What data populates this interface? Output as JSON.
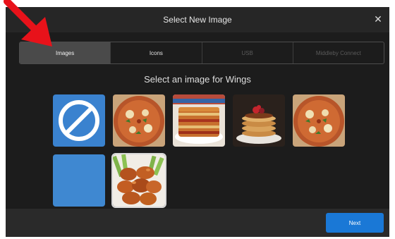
{
  "dialog": {
    "title": "Select New Image",
    "close_glyph": "✕",
    "prompt": "Select an image for Wings"
  },
  "tabs": [
    {
      "label": "Images",
      "state": "active"
    },
    {
      "label": "Icons",
      "state": "enabled"
    },
    {
      "label": "USB",
      "state": "disabled"
    },
    {
      "label": "Middleby Connect",
      "state": "disabled"
    }
  ],
  "images": [
    {
      "name": "no-image-icon",
      "kind": "blocked",
      "color": "#3a82cf"
    },
    {
      "name": "pizza",
      "kind": "photo"
    },
    {
      "name": "lasagna",
      "kind": "photo"
    },
    {
      "name": "pancakes",
      "kind": "photo"
    },
    {
      "name": "pizza",
      "kind": "photo"
    },
    {
      "name": "solid-blue",
      "kind": "color",
      "color": "#3f88d1"
    },
    {
      "name": "chicken-wings",
      "kind": "photo",
      "selected": true
    }
  ],
  "footer": {
    "next_label": "Next"
  },
  "annotation": {
    "arrow_color": "#e8121a"
  }
}
